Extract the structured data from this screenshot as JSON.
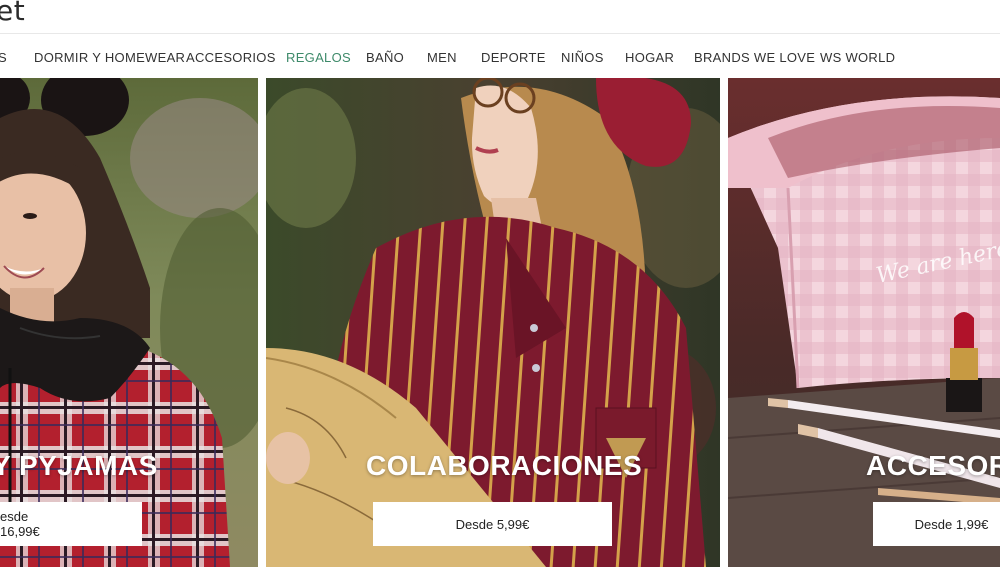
{
  "header": {
    "logo_fragment": "et"
  },
  "nav": {
    "items": [
      {
        "label": "S"
      },
      {
        "label": "DORMIR Y HOMEWEAR"
      },
      {
        "label": "ACCESORIOS"
      },
      {
        "label": "REGALOS",
        "active": true
      },
      {
        "label": "BAÑO"
      },
      {
        "label": "MEN"
      },
      {
        "label": "DEPORTE"
      },
      {
        "label": "NIÑOS"
      },
      {
        "label": "HOGAR"
      },
      {
        "label": "BRANDS WE LOVE"
      },
      {
        "label": "WS WORLD"
      }
    ],
    "active_color": "#3e8a6a"
  },
  "panels": [
    {
      "title": "Y PYJAMAS",
      "price": "esde 16,99€"
    },
    {
      "title": "COLABORACIONES",
      "price": "Desde 5,99€"
    },
    {
      "title": "ACCESOR",
      "price": "Desde 1,99€"
    }
  ],
  "product_text": {
    "bag_print": "We are here to shine"
  }
}
